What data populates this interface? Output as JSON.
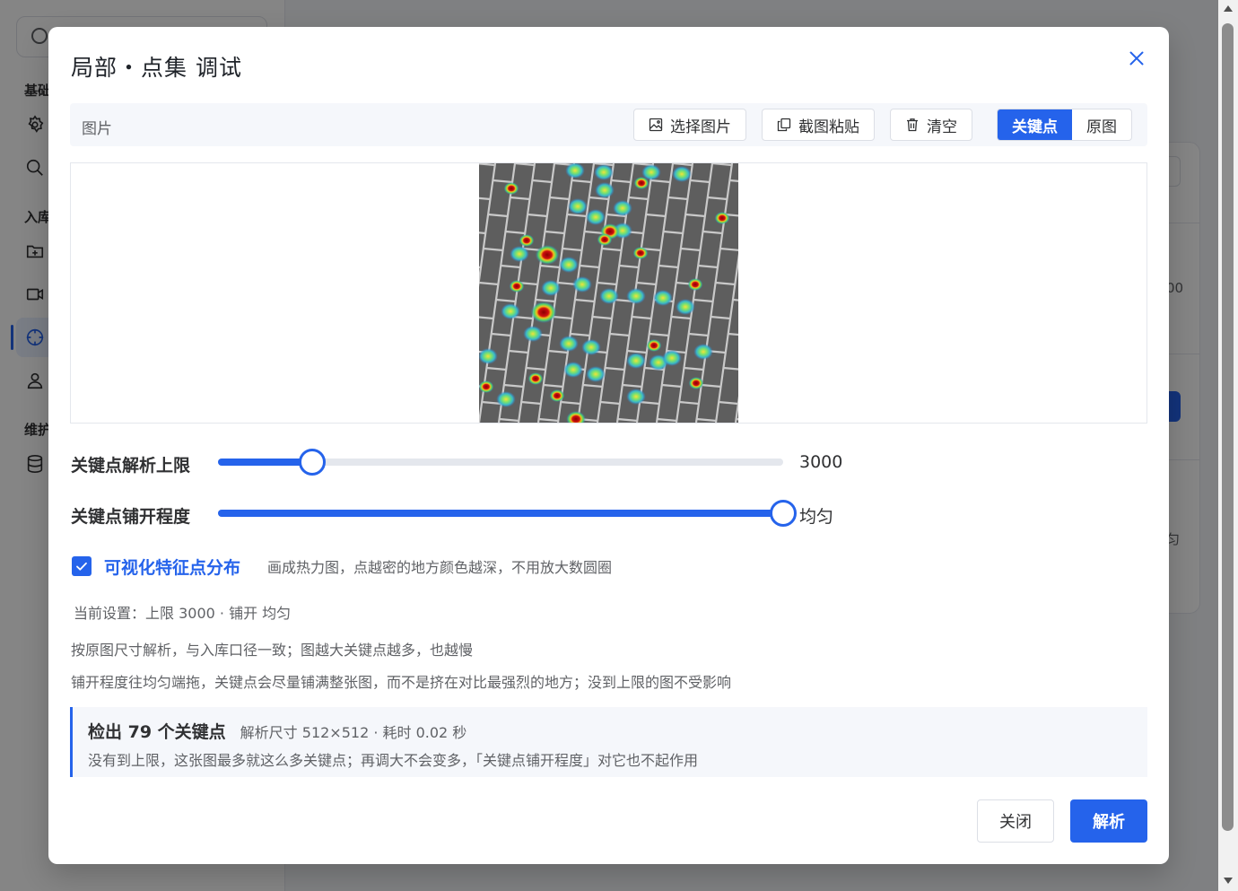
{
  "background": {
    "groups": [
      "基础",
      "入库",
      "维护"
    ],
    "right_texts": [
      "00",
      "匀"
    ]
  },
  "dialog": {
    "title": "局部・点集 调试",
    "toolbar": {
      "label": "图片",
      "select_image": "选择图片",
      "paste_screenshot": "截图粘贴",
      "clear": "清空",
      "view_keypoints": "关键点",
      "view_original": "原图",
      "active_view": "关键点"
    },
    "sliders": {
      "limit": {
        "label": "关键点解析上限",
        "value": "3000",
        "fraction": 0.166
      },
      "spread": {
        "label": "关键点铺开程度",
        "value": "均匀",
        "fraction": 1.0
      }
    },
    "visualize": {
      "checked": true,
      "label": "可视化特征点分布",
      "desc": "画成热力图，点越密的地方颜色越深，不用放大数圆圈"
    },
    "current_settings": "当前设置：上限 3000 · 铺开 均匀",
    "notes": [
      "按原图尺寸解析，与入库口径一致；图越大关键点越多，也越慢",
      "铺开程度往均匀端拖，关键点会尽量铺满整张图，而不是挤在对比最强烈的地方；没到上限的图不受影响"
    ],
    "result": {
      "title": "检出 79 个关键点",
      "meta": "解析尺寸 512×512 · 耗时 0.02 秒",
      "detail": "没有到上限，这张图最多就这么多关键点；再调大不会变多，「关键点铺开程度」对它也不起作用"
    },
    "buttons": {
      "close": "关闭",
      "parse": "解析"
    }
  },
  "colors": {
    "accent": "#2563eb"
  }
}
